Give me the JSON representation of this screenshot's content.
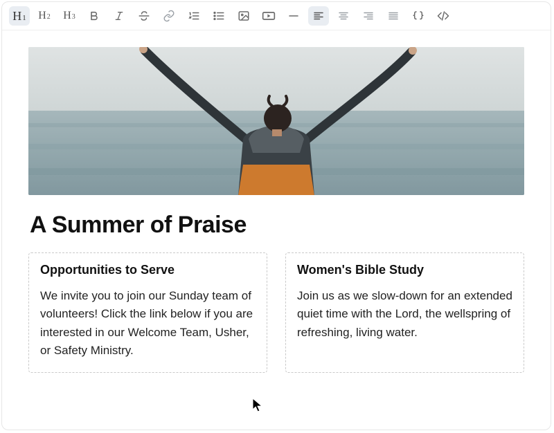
{
  "toolbar": {
    "h1": {
      "H": "H",
      "n": "1"
    },
    "h2": {
      "H": "H",
      "n": "2"
    },
    "h3": {
      "H": "H",
      "n": "3"
    }
  },
  "document": {
    "title": "A Summer of Praise",
    "columns": [
      {
        "heading": "Opportunities to Serve",
        "body": "We invite you to join our Sunday team of volunteers! Click the link below if you are interested in our Welcome Team, Usher, or Safety Ministry."
      },
      {
        "heading": "Women's Bible Study",
        "body": "Join us as we slow-down for an extended quiet time with the Lord, the wellspring of refreshing, living water."
      }
    ]
  }
}
